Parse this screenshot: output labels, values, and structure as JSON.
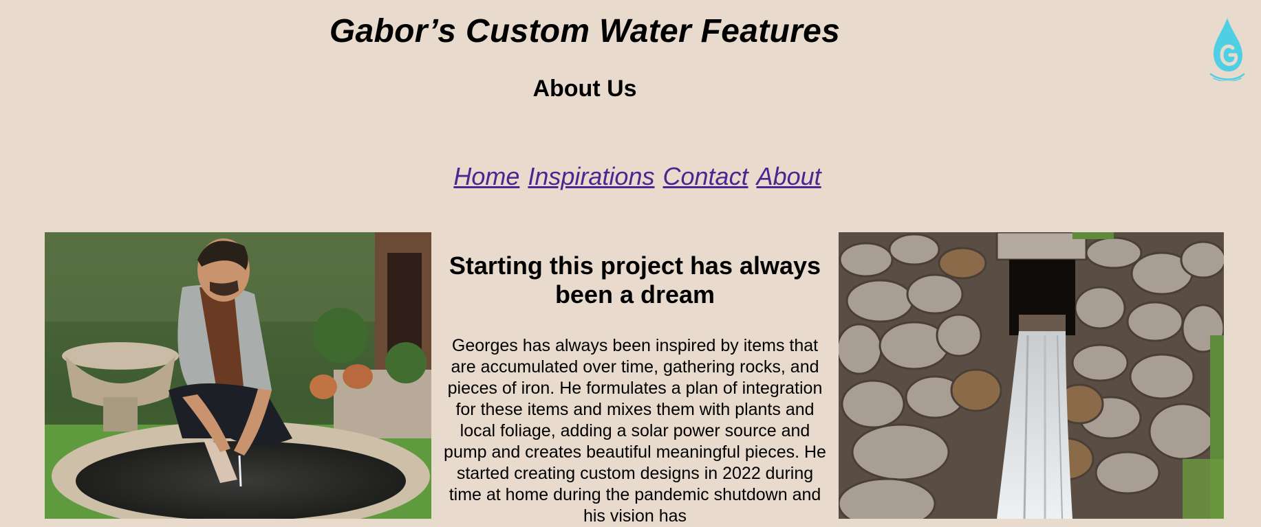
{
  "header": {
    "site_title": "Gabor’s Custom Water Features",
    "page_heading": "About Us",
    "logo_icon": "water-drop-g-logo-icon",
    "logo_color": "#4fcfe3"
  },
  "nav": {
    "items": [
      {
        "label": "Home"
      },
      {
        "label": "Inspirations"
      },
      {
        "label": "Contact"
      },
      {
        "label": "About"
      }
    ],
    "link_color": "#4b2590"
  },
  "main": {
    "left_image": "man-with-stone-fountain-photo",
    "right_image": "stone-wall-waterfall-photo",
    "heading": "Starting this project has always been a dream",
    "paragraph": "Georges has always been inspired by items that are accumulated over time, gathering rocks, and pieces of iron. He formulates a plan of integration for these items and mixes them with plants and local foliage, adding a solar power source and pump and creates beautiful meaningful pieces. He started creating custom designs in 2022 during time at home during the pandemic shutdown and his vision has"
  },
  "colors": {
    "background": "#e8dacc"
  }
}
